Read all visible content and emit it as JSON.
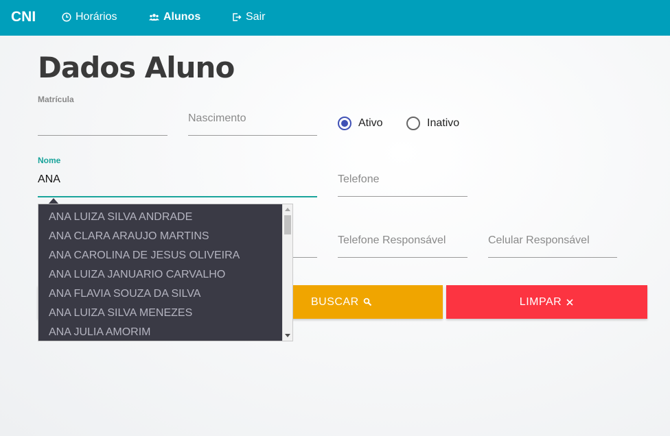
{
  "nav": {
    "brand": "CNI",
    "items": [
      {
        "label": "Horários",
        "icon": "clock-icon"
      },
      {
        "label": "Alunos",
        "icon": "users-icon"
      },
      {
        "label": "Sair",
        "icon": "logout-icon"
      }
    ]
  },
  "page": {
    "title": "Dados Aluno"
  },
  "form": {
    "matricula": {
      "label": "Matrícula",
      "value": ""
    },
    "nascimento": {
      "placeholder": "Nascimento"
    },
    "status": {
      "options": [
        "Ativo",
        "Inativo"
      ],
      "selected": "Ativo"
    },
    "nome": {
      "label": "Nome",
      "value": "ANA"
    },
    "telefone": {
      "placeholder": "Telefone"
    },
    "telefone_responsavel": {
      "placeholder": "Telefone Responsável"
    },
    "celular_responsavel": {
      "placeholder": "Celular Responsável"
    }
  },
  "autocomplete": {
    "suggestions": [
      "ANA LUIZA SILVA ANDRADE",
      "ANA CLARA ARAUJO MARTINS",
      "ANA CAROLINA DE JESUS OLIVEIRA",
      "ANA LUIZA JANUARIO CARVALHO",
      "ANA FLAVIA SOUZA DA SILVA",
      "ANA LUIZA SILVA MENEZES",
      "ANA JULIA AMORIM"
    ]
  },
  "buttons": {
    "buscar": {
      "label": "BUSCAR",
      "icon": "search-icon",
      "color": "#f0a500"
    },
    "limpar": {
      "label": "LIMPAR",
      "icon": "close-icon",
      "color": "#fc3441"
    }
  },
  "colors": {
    "navbar": "#009fbb",
    "accent": "#19a49b",
    "radio": "#3f51b5",
    "dropdown_bg": "#3a3a45"
  }
}
